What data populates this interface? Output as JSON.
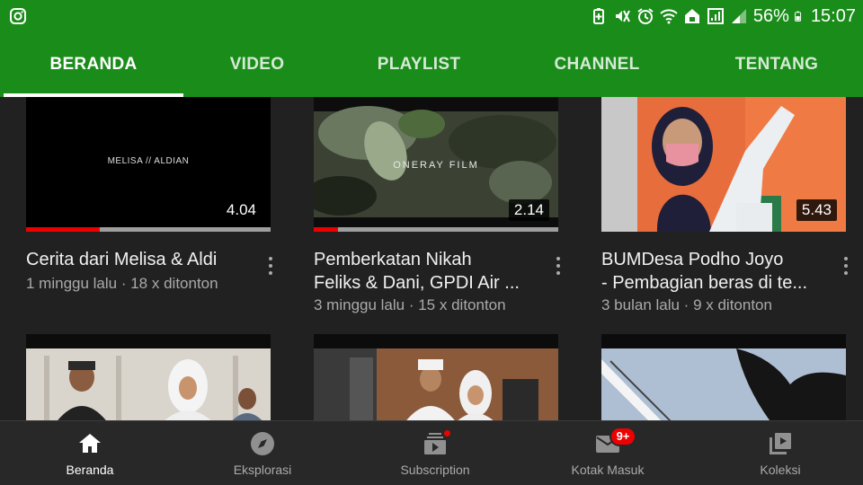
{
  "status_bar": {
    "left_icon": "instagram-icon",
    "icons": [
      "battery-saver-icon",
      "mute-icon",
      "alarm-icon",
      "wifi-icon",
      "data-saver-icon",
      "signal-icon"
    ],
    "battery": "56%",
    "time": "15:07"
  },
  "tabs": [
    {
      "label": "BERANDA",
      "active": true
    },
    {
      "label": "VIDEO",
      "active": false
    },
    {
      "label": "PLAYLIST",
      "active": false
    },
    {
      "label": "CHANNEL",
      "active": false
    },
    {
      "label": "TENTANG",
      "active": false
    }
  ],
  "videos": [
    {
      "title_line1": "Cerita dari Melisa & Aldi",
      "title_line2": "",
      "meta": "1 minggu lalu · 18 x ditonton",
      "duration": "4.04",
      "thumb_text": "MELISA // ALDIAN",
      "progress": 0.3
    },
    {
      "title_line1": "Pemberkatan Nikah",
      "title_line2": "Feliks & Dani, GPDI Air ...",
      "meta": "3 minggu lalu · 15 x ditonton",
      "duration": "2.14",
      "thumb_text": "ONERAY FILM",
      "progress": 0.1
    },
    {
      "title_line1": "BUMDesa Podho Joyo",
      "title_line2": "- Pembagian beras di te...",
      "meta": "3 bulan lalu · 9 x ditonton",
      "duration": "5.43",
      "thumb_text": "",
      "progress": 0
    }
  ],
  "bottom_nav": [
    {
      "label": "Beranda",
      "icon": "home-icon",
      "active": true
    },
    {
      "label": "Eksplorasi",
      "icon": "compass-icon",
      "active": false
    },
    {
      "label": "Subscription",
      "icon": "subscriptions-icon",
      "active": false,
      "dot": true
    },
    {
      "label": "Kotak Masuk",
      "icon": "mail-icon",
      "active": false,
      "badge": "9+"
    },
    {
      "label": "Koleksi",
      "icon": "library-icon",
      "active": false
    }
  ],
  "colors": {
    "brand_green": "#1a8c1a",
    "background": "#212121",
    "progress_red": "#ee0000"
  }
}
